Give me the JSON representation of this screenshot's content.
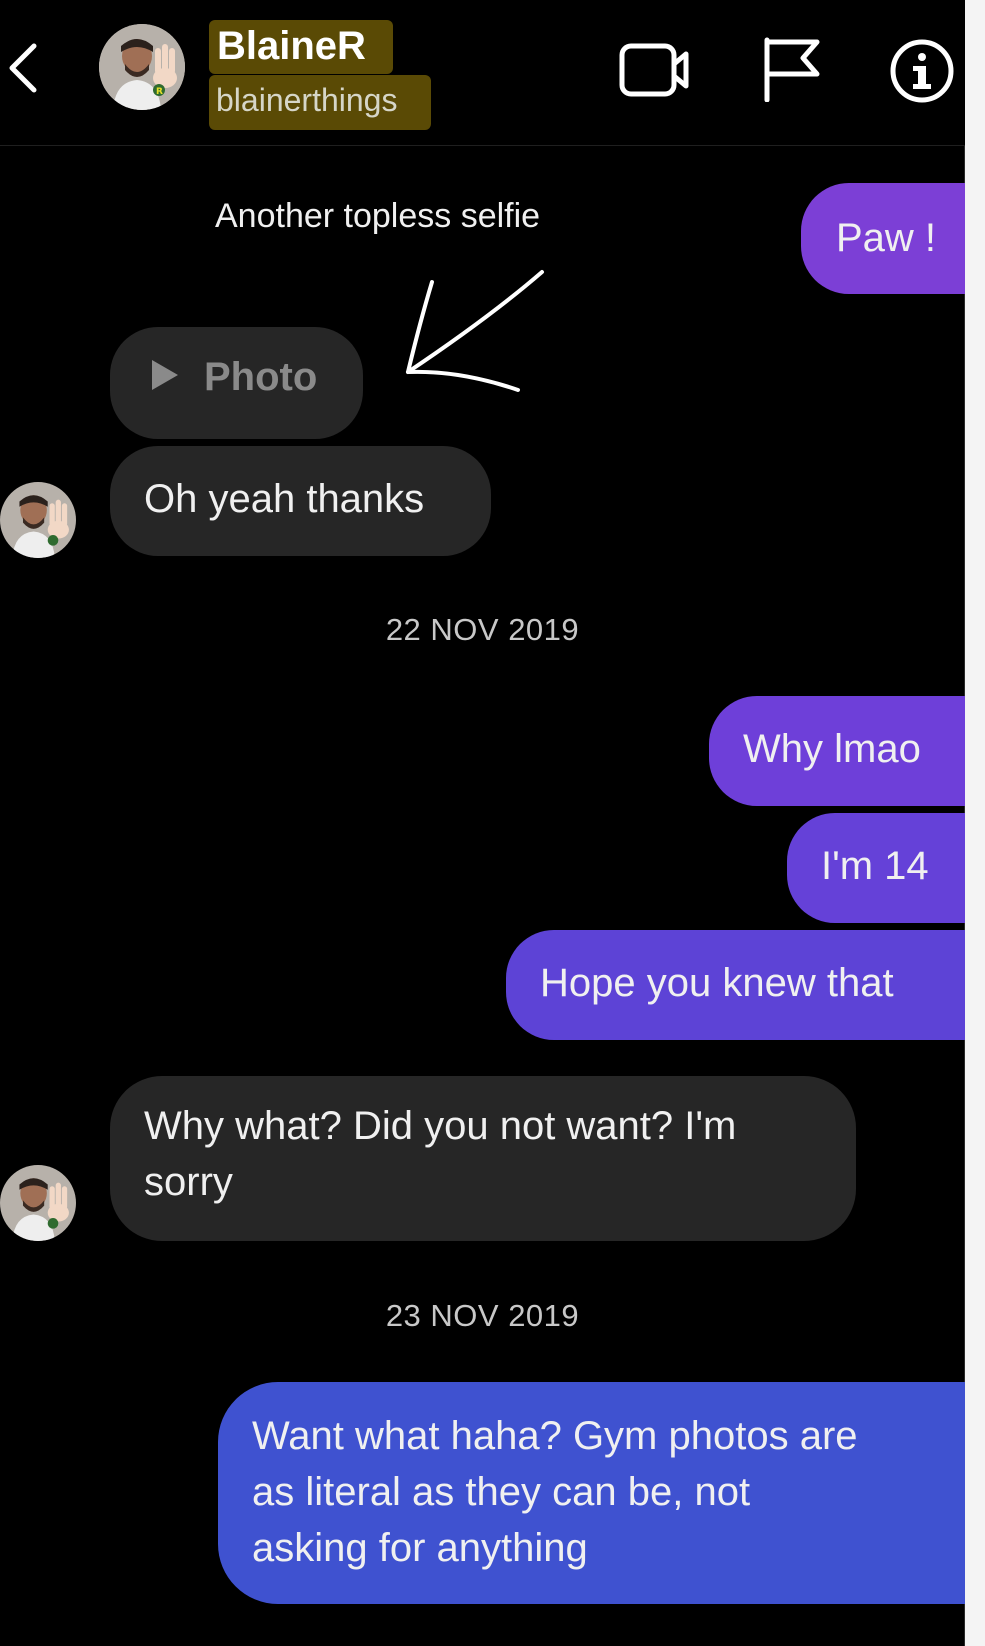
{
  "header": {
    "contact_name": "BlaineR",
    "contact_handle": "blainerthings",
    "icons": [
      "back-icon",
      "avatar",
      "video-call-icon",
      "flag-icon",
      "info-icon"
    ],
    "highlight_color": "#5a4a05"
  },
  "annotation": {
    "note": "Another topless selfie"
  },
  "messages": [
    {
      "sender": "me",
      "text": "Paw !",
      "color": "#7c3fd6"
    },
    {
      "sender": "them",
      "type": "photo",
      "text": "Photo"
    },
    {
      "sender": "them",
      "text": "Oh yeah thanks"
    },
    {
      "type": "date",
      "text": "22 NOV 2019"
    },
    {
      "sender": "me",
      "text": "Why lmao",
      "color": "#6e3fd9"
    },
    {
      "sender": "me",
      "text": "I'm 14",
      "color": "#6541d8"
    },
    {
      "sender": "me",
      "text": "Hope you knew that",
      "color": "#5d43d6"
    },
    {
      "sender": "them",
      "lines": [
        "Why what? Did you not want? I'm",
        "sorry"
      ]
    },
    {
      "type": "date",
      "text": "23 NOV 2019"
    },
    {
      "sender": "me",
      "lines": [
        "Want what haha? Gym photos are",
        "as literal as they can be, not",
        "asking for anything"
      ],
      "color": "#3f52d0"
    }
  ],
  "colors": {
    "background": "#000000",
    "incoming_bubble": "#262626",
    "outgoing_gradient_top": "#8a3fd6",
    "outgoing_gradient_bottom": "#3a55cf"
  }
}
